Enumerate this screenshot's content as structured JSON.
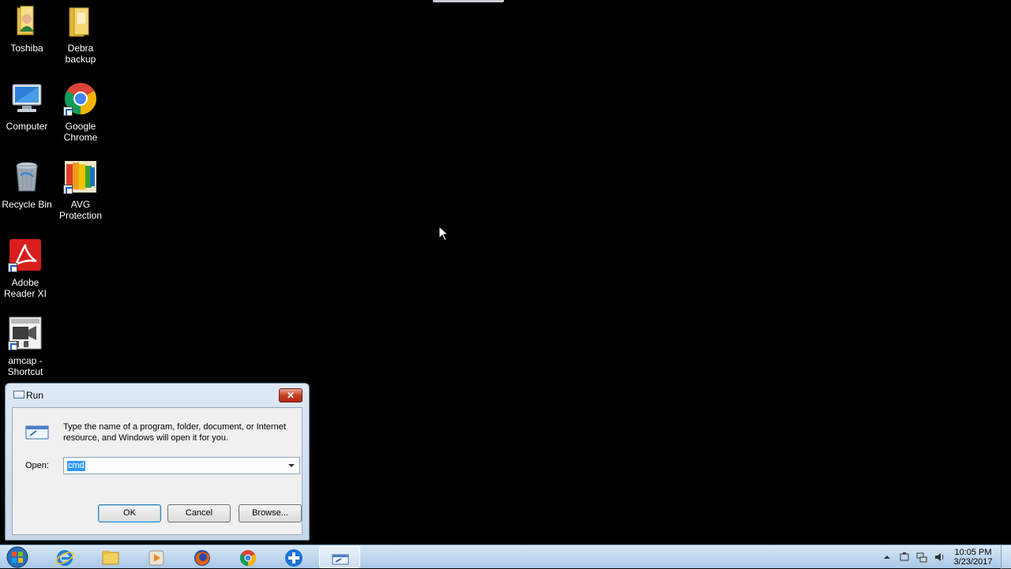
{
  "desktop": {
    "icons": [
      {
        "name": "toshiba",
        "label": "Toshiba"
      },
      {
        "name": "debra-backup",
        "label": "Debra backup"
      },
      {
        "name": "computer",
        "label": "Computer"
      },
      {
        "name": "google-chrome",
        "label": "Google Chrome"
      },
      {
        "name": "recycle-bin",
        "label": "Recycle Bin"
      },
      {
        "name": "avg-protection",
        "label": "AVG Protection"
      },
      {
        "name": "adobe-reader",
        "label": "Adobe Reader XI"
      },
      {
        "name": "amcap-shortcut",
        "label": "amcap - Shortcut"
      }
    ]
  },
  "run_dialog": {
    "title": "Run",
    "description": "Type the name of a program, folder, document, or Internet resource, and Windows will open it for you.",
    "open_label": "Open:",
    "open_value": "cmd",
    "ok_label": "OK",
    "cancel_label": "Cancel",
    "browse_label": "Browse...",
    "close_glyph": "✕"
  },
  "taskbar": {
    "items": [
      "start-orb",
      "internet-explorer-icon",
      "file-explorer-icon",
      "media-player-icon",
      "firefox-icon",
      "chrome-icon",
      "app-plus-icon",
      "run-icon"
    ],
    "clock_time": "10:05 PM",
    "clock_date": "3/23/2017"
  },
  "colors": {
    "desktop_bg": "#000000",
    "taskbar_bg": "#a9c7e6",
    "selection": "#3399ff",
    "close_red": "#c6412a"
  }
}
